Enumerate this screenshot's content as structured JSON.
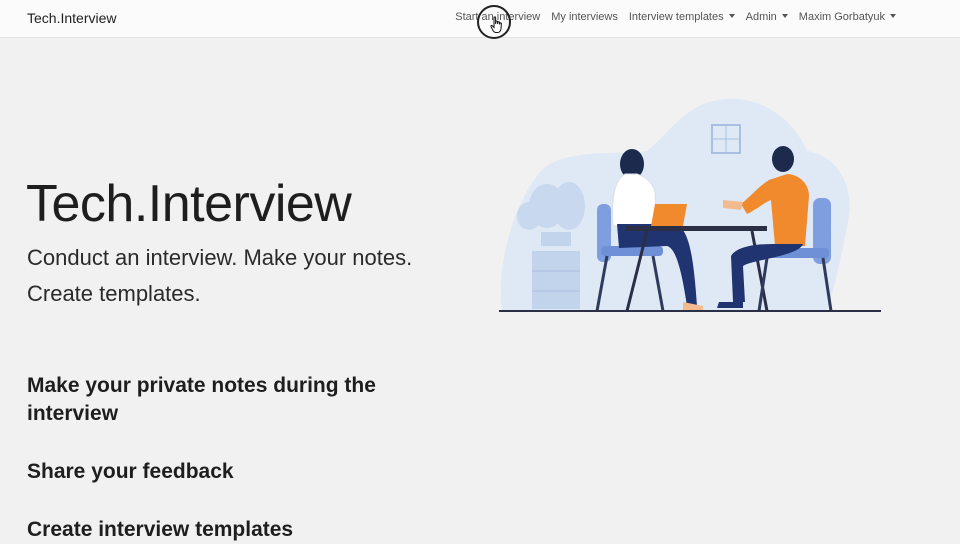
{
  "navbar": {
    "brand": "Tech.Interview",
    "links": [
      {
        "label": "Start an interview",
        "dropdown": false
      },
      {
        "label": "My interviews",
        "dropdown": false
      },
      {
        "label": "Interview templates",
        "dropdown": true
      },
      {
        "label": "Admin",
        "dropdown": true
      },
      {
        "label": "Maxim Gorbatyuk",
        "dropdown": true
      }
    ]
  },
  "hero": {
    "title": "Tech.Interview",
    "lead": "Conduct an interview. Make your notes. Create templates."
  },
  "illustration": {
    "icon": "interview-illustration",
    "accent_color": "#f08a2c",
    "blob_color": "#dfe9f5",
    "chair_color": "#6f8fd6"
  },
  "features": [
    {
      "title": "Make your private notes during the interview"
    },
    {
      "title": "Share your feedback"
    },
    {
      "title": "Create interview templates"
    }
  ],
  "colors": {
    "background": "#f1f1f1",
    "navbar_bg": "#fbfbfb",
    "text": "#1e1e1e"
  }
}
